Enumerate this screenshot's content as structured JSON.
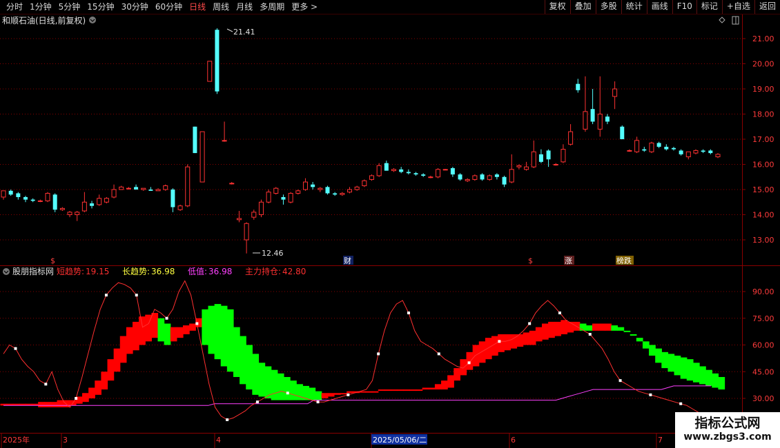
{
  "toolbar": {
    "periods": [
      {
        "label": "分时",
        "active": false
      },
      {
        "label": "1分钟",
        "active": false
      },
      {
        "label": "5分钟",
        "active": false
      },
      {
        "label": "15分钟",
        "active": false
      },
      {
        "label": "30分钟",
        "active": false
      },
      {
        "label": "60分钟",
        "active": false
      },
      {
        "label": "日线",
        "active": true
      },
      {
        "label": "周线",
        "active": false
      },
      {
        "label": "月线",
        "active": false
      },
      {
        "label": "多周期",
        "active": false
      },
      {
        "label": "更多 >",
        "active": false
      }
    ],
    "buttons": [
      "复权",
      "叠加",
      "多股",
      "统计",
      "画线",
      "F10",
      "标记",
      "+自选",
      "返回"
    ]
  },
  "price_panel": {
    "title": "和顺石油(日线,前复权)",
    "high_label": "21.41",
    "low_label": "12.46",
    "y_ticks": [
      "21.00",
      "20.00",
      "19.00",
      "18.00",
      "17.00",
      "16.00",
      "15.00",
      "14.00",
      "13.00"
    ],
    "markers": [
      "$",
      "财",
      "$",
      "涨",
      "榜跌"
    ]
  },
  "indicator_panel": {
    "name": "股朋指标网",
    "items": [
      {
        "label": "短趋势:",
        "value": "19.15",
        "color": "#ff3030"
      },
      {
        "label": "长趋势:",
        "value": "36.98",
        "color": "#ffff40"
      },
      {
        "label": "低值:",
        "value": "36.98",
        "color": "#ff40ff"
      },
      {
        "label": "主力持仓:",
        "value": "42.80",
        "color": "#ff3030"
      }
    ],
    "y_ticks": [
      "90.00",
      "75.00",
      "60.00",
      "45.00",
      "30.00"
    ]
  },
  "date_axis": {
    "labels": [
      "2025年",
      "3",
      "4",
      "2025/05/06/二",
      "6",
      "7"
    ]
  },
  "watermark": {
    "title": "指标公式网",
    "url": "www.zbgs3.com"
  },
  "colors": {
    "up": "#ff3232",
    "down": "#54ffff",
    "grid": "#8b0000",
    "band_up": "#ff0000",
    "band_down": "#00ff00",
    "low_line": "#ff40ff"
  },
  "chart_data": {
    "type": "candlestick",
    "price_axis": {
      "ylim": [
        12.2,
        21.9
      ]
    },
    "candles": [
      [
        14.7,
        14.95,
        14.6,
        14.95
      ],
      [
        14.95,
        15.0,
        14.75,
        14.8
      ],
      [
        14.85,
        14.9,
        14.6,
        14.7
      ],
      [
        14.7,
        14.75,
        14.5,
        14.6
      ],
      [
        14.6,
        14.65,
        14.5,
        14.55
      ],
      [
        14.55,
        14.6,
        14.5,
        14.55
      ],
      [
        14.55,
        14.9,
        14.5,
        14.85
      ],
      [
        14.8,
        14.85,
        14.1,
        14.2
      ],
      [
        14.2,
        14.3,
        14.15,
        14.25
      ],
      [
        14.0,
        14.15,
        13.9,
        14.1
      ],
      [
        14.0,
        14.15,
        13.75,
        14.1
      ],
      [
        14.15,
        14.9,
        14.1,
        14.5
      ],
      [
        14.45,
        14.55,
        14.25,
        14.35
      ],
      [
        14.4,
        14.8,
        14.35,
        14.65
      ],
      [
        14.5,
        14.7,
        14.45,
        14.65
      ],
      [
        14.7,
        15.2,
        14.65,
        15.0
      ],
      [
        15.0,
        15.15,
        15.0,
        15.1
      ],
      [
        15.05,
        15.1,
        15.0,
        15.05
      ],
      [
        15.1,
        15.2,
        15.0,
        15.0
      ],
      [
        15.0,
        15.05,
        14.95,
        15.05
      ],
      [
        15.0,
        15.1,
        14.95,
        14.95
      ],
      [
        14.95,
        15.05,
        14.95,
        15.0
      ],
      [
        15.0,
        15.2,
        14.95,
        15.15
      ],
      [
        15.0,
        15.05,
        14.1,
        14.3
      ],
      [
        14.2,
        14.4,
        14.15,
        14.35
      ],
      [
        14.35,
        16.0,
        14.3,
        15.9
      ],
      [
        17.5,
        17.5,
        16.45,
        16.45
      ],
      [
        15.3,
        17.3,
        15.3,
        17.3
      ],
      [
        19.3,
        20.1,
        19.3,
        20.1
      ],
      [
        21.35,
        21.41,
        18.8,
        18.9
      ],
      [
        16.95,
        17.7,
        16.9,
        16.95
      ],
      [
        15.25,
        15.3,
        15.2,
        15.25
      ],
      [
        13.8,
        14.15,
        13.7,
        13.85
      ],
      [
        13.0,
        13.7,
        12.46,
        13.65
      ],
      [
        13.9,
        14.2,
        13.8,
        14.1
      ],
      [
        14.0,
        14.6,
        13.9,
        14.5
      ],
      [
        14.5,
        15.0,
        14.45,
        14.9
      ],
      [
        14.85,
        15.1,
        14.8,
        15.05
      ],
      [
        14.7,
        14.8,
        14.4,
        14.6
      ],
      [
        14.5,
        14.9,
        14.45,
        14.85
      ],
      [
        14.85,
        15.0,
        14.8,
        14.95
      ],
      [
        15.0,
        15.45,
        14.95,
        15.3
      ],
      [
        15.2,
        15.3,
        15.0,
        15.1
      ],
      [
        15.0,
        15.1,
        14.9,
        15.05
      ],
      [
        15.1,
        15.15,
        14.8,
        14.85
      ],
      [
        14.85,
        14.9,
        14.75,
        14.8
      ],
      [
        14.8,
        14.9,
        14.75,
        14.85
      ],
      [
        14.9,
        15.1,
        14.85,
        15.0
      ],
      [
        15.0,
        15.15,
        14.95,
        15.1
      ],
      [
        15.15,
        15.4,
        15.1,
        15.35
      ],
      [
        15.4,
        15.6,
        15.35,
        15.55
      ],
      [
        15.55,
        16.05,
        15.5,
        15.95
      ],
      [
        16.05,
        16.15,
        15.75,
        15.75
      ],
      [
        15.75,
        15.85,
        15.7,
        15.8
      ],
      [
        15.8,
        15.9,
        15.65,
        15.7
      ],
      [
        15.7,
        15.8,
        15.6,
        15.65
      ],
      [
        15.65,
        15.7,
        15.55,
        15.6
      ],
      [
        15.6,
        15.65,
        15.5,
        15.55
      ],
      [
        15.5,
        15.55,
        15.45,
        15.5
      ],
      [
        15.5,
        15.85,
        15.45,
        15.8
      ],
      [
        15.8,
        15.82,
        15.8,
        15.8
      ],
      [
        15.85,
        15.9,
        15.5,
        15.6
      ],
      [
        15.6,
        15.65,
        15.35,
        15.4
      ],
      [
        15.35,
        15.45,
        15.3,
        15.4
      ],
      [
        15.4,
        15.6,
        15.35,
        15.55
      ],
      [
        15.6,
        15.65,
        15.35,
        15.4
      ],
      [
        15.4,
        15.6,
        15.35,
        15.55
      ],
      [
        15.6,
        15.65,
        15.4,
        15.5
      ],
      [
        15.5,
        15.55,
        15.1,
        15.2
      ],
      [
        15.3,
        16.4,
        15.25,
        15.8
      ],
      [
        15.9,
        16.0,
        15.8,
        15.95
      ],
      [
        15.8,
        16.1,
        15.75,
        15.9
      ],
      [
        15.9,
        16.95,
        15.85,
        16.5
      ],
      [
        16.4,
        16.6,
        16.05,
        16.1
      ],
      [
        16.55,
        16.6,
        15.9,
        16.2
      ],
      [
        16.0,
        16.05,
        15.95,
        16.0
      ],
      [
        16.1,
        16.8,
        16.05,
        16.6
      ],
      [
        16.8,
        17.6,
        16.75,
        17.3
      ],
      [
        19.2,
        19.4,
        18.85,
        18.95
      ],
      [
        17.4,
        19.5,
        17.3,
        18.1
      ],
      [
        18.2,
        19.0,
        17.6,
        17.7
      ],
      [
        17.4,
        19.5,
        17.1,
        18.0
      ],
      [
        17.9,
        18.0,
        17.6,
        17.7
      ],
      [
        18.7,
        19.3,
        18.2,
        19.0
      ],
      [
        17.5,
        17.55,
        17.0,
        17.0
      ],
      [
        16.55,
        16.6,
        16.5,
        16.55
      ],
      [
        16.5,
        17.1,
        16.45,
        16.95
      ],
      [
        16.6,
        16.7,
        16.5,
        16.55
      ],
      [
        16.5,
        16.9,
        16.45,
        16.85
      ],
      [
        16.85,
        16.9,
        16.65,
        16.7
      ],
      [
        16.7,
        16.8,
        16.55,
        16.6
      ],
      [
        16.65,
        16.7,
        16.55,
        16.6
      ],
      [
        16.55,
        16.6,
        16.35,
        16.4
      ],
      [
        16.3,
        16.5,
        16.2,
        16.5
      ],
      [
        16.45,
        16.6,
        16.4,
        16.55
      ],
      [
        16.55,
        16.6,
        16.45,
        16.5
      ],
      [
        16.55,
        16.6,
        16.4,
        16.45
      ],
      [
        16.3,
        16.45,
        16.25,
        16.4
      ]
    ],
    "indicator_axis": {
      "ylim": [
        22,
        100
      ]
    },
    "band_upper": [
      27,
      27,
      27,
      27,
      27,
      27,
      28,
      28,
      28,
      29,
      29,
      29,
      31,
      33,
      36,
      40,
      45,
      52,
      58,
      65,
      70,
      73,
      76,
      77,
      78,
      75,
      72,
      70,
      70,
      71,
      72,
      75,
      80,
      82,
      83,
      82,
      80,
      70,
      65,
      60,
      55,
      50,
      48,
      46,
      44,
      42,
      40,
      38,
      37,
      36,
      34,
      33,
      33,
      33,
      33,
      34,
      34,
      34,
      34,
      34,
      35,
      35,
      35,
      35,
      35,
      35,
      35,
      36,
      36,
      38,
      40,
      43,
      47,
      52,
      56,
      60,
      62,
      64,
      65,
      66,
      66,
      66,
      66,
      67,
      68,
      70,
      72,
      73,
      73,
      74,
      73,
      73,
      72,
      71,
      72,
      72,
      72,
      71,
      70,
      68,
      66,
      64,
      62,
      60,
      58,
      56,
      55,
      54,
      53,
      52,
      50,
      48,
      46,
      44,
      42
    ],
    "band_lower": [
      26,
      26,
      26,
      26,
      26,
      26,
      25,
      25,
      25,
      25,
      25,
      26,
      27,
      28,
      30,
      32,
      35,
      40,
      45,
      50,
      55,
      57,
      60,
      62,
      64,
      62,
      60,
      62,
      64,
      66,
      68,
      70,
      60,
      55,
      52,
      48,
      45,
      42,
      38,
      35,
      32,
      31,
      30,
      29,
      29,
      29,
      29,
      29,
      29,
      29,
      29,
      30,
      31,
      32,
      33,
      33,
      33,
      34,
      34,
      34,
      35,
      35,
      35,
      35,
      35,
      35,
      35,
      35,
      35,
      35,
      35,
      36,
      40,
      43,
      46,
      48,
      50,
      52,
      54,
      56,
      57,
      58,
      59,
      60,
      60,
      62,
      63,
      64,
      65,
      66,
      67,
      68,
      68,
      68,
      68,
      68,
      68,
      68,
      68,
      68,
      66,
      62,
      58,
      54,
      50,
      47,
      45,
      43,
      41,
      40,
      39,
      38,
      37,
      36,
      35
    ],
    "short_trend": [
      55,
      60,
      58,
      52,
      48,
      45,
      40,
      38,
      45,
      35,
      28,
      25,
      30,
      42,
      55,
      68,
      80,
      88,
      92,
      95,
      94,
      92,
      88,
      70,
      72,
      80,
      78,
      75,
      80,
      90,
      96,
      88,
      72,
      55,
      38,
      25,
      20,
      18,
      19,
      21,
      23,
      26,
      28,
      30,
      32,
      33,
      34,
      33,
      32,
      31,
      30,
      29,
      28,
      28,
      29,
      30,
      31,
      32,
      33,
      34,
      35,
      40,
      55,
      68,
      78,
      83,
      85,
      78,
      68,
      62,
      60,
      58,
      55,
      52,
      50,
      48,
      47,
      50,
      54,
      56,
      58,
      60,
      62,
      62,
      63,
      65,
      68,
      72,
      78,
      82,
      85,
      82,
      78,
      74,
      72,
      70,
      68,
      66,
      62,
      58,
      52,
      45,
      40,
      38,
      36,
      34,
      33,
      32,
      31,
      30,
      29,
      28,
      27,
      26,
      24,
      22,
      20,
      19
    ],
    "low_line": [
      26,
      26,
      26,
      26,
      26,
      26,
      26,
      26,
      26,
      26,
      26,
      26,
      26,
      26,
      26,
      26,
      26,
      26,
      26,
      26,
      26,
      26,
      26,
      26,
      26,
      26,
      26,
      26,
      26,
      26,
      26,
      26,
      26,
      26,
      27,
      27,
      27,
      27,
      27,
      27,
      27,
      27,
      27,
      27,
      27,
      27,
      27,
      27,
      27,
      27,
      29,
      29,
      29,
      29,
      29,
      29,
      29,
      29,
      29,
      29,
      29,
      29,
      29,
      29,
      29,
      29,
      29,
      29,
      29,
      29,
      29,
      29,
      29,
      29,
      29,
      29,
      29,
      29,
      29,
      29,
      29,
      29,
      29,
      29,
      29,
      29,
      29,
      29,
      29,
      29,
      30,
      31,
      32,
      33,
      34,
      35,
      35,
      35,
      35,
      35,
      35,
      35,
      35,
      35,
      35,
      35,
      35,
      36,
      37,
      37,
      37,
      37,
      37,
      37,
      37
    ]
  }
}
